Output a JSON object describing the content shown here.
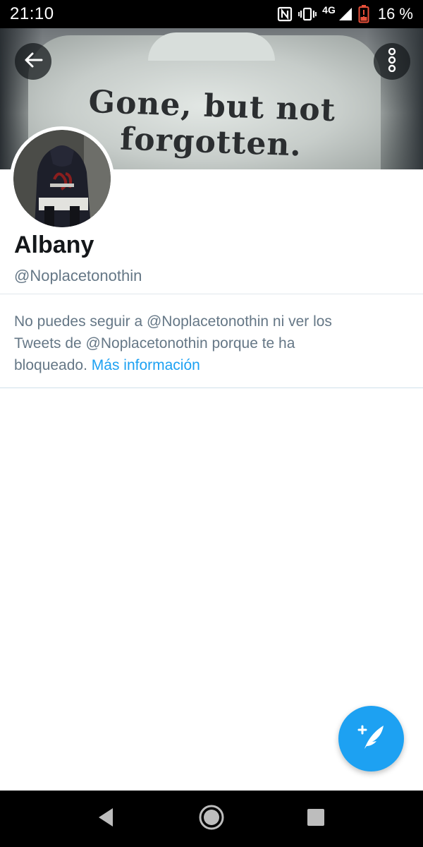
{
  "status_bar": {
    "time": "21:10",
    "network": "4G",
    "battery_percent": "16 %",
    "icons": [
      "nfc-icon",
      "vibrate-icon",
      "signal-icon",
      "battery-low-icon"
    ]
  },
  "header": {
    "banner_text": "Gone, but not forgotten.",
    "back_icon": "arrow-left-icon",
    "more_icon": "more-vertical-icon"
  },
  "profile": {
    "name": "Albany",
    "handle": "@Noplacetonothin"
  },
  "blocked_notice": {
    "text": "No puedes seguir a @Noplacetonothin ni ver los Tweets de @Noplacetonothin porque te ha bloqueado.",
    "link_label": "Más información"
  },
  "fab": {
    "icon": "compose-tweet-icon"
  },
  "nav_bar": {
    "icons": [
      "nav-back-icon",
      "nav-home-icon",
      "nav-recents-icon"
    ]
  },
  "colors": {
    "accent": "#1da1f2",
    "secondary_text": "#657786",
    "primary_text": "#14171a",
    "divider": "#e1e8ed"
  }
}
